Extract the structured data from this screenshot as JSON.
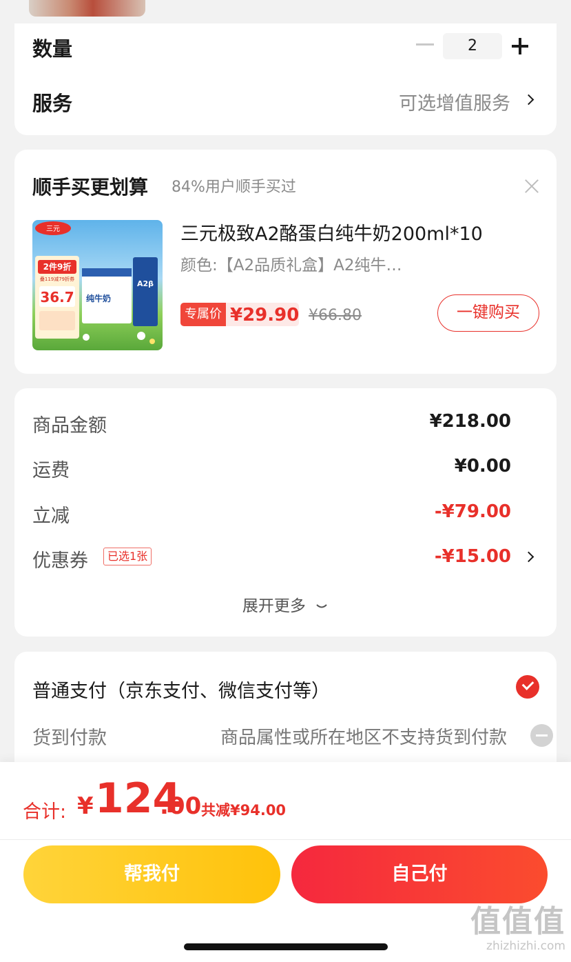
{
  "quantity": {
    "label": "数量",
    "value": "2"
  },
  "service": {
    "label": "服务",
    "value": "可选增值服务"
  },
  "upsell": {
    "title": "顺手买更划算",
    "subtitle": "84%用户顺手买过",
    "product": {
      "title": "三元极致A2酪蛋白纯牛奶200ml*10",
      "variant": "颜色:【A2品质礼盒】A2纯牛…",
      "price_label": "专属价",
      "price": "¥29.90",
      "original_price": "¥66.80",
      "buy_button": "一键购买",
      "image_texts": {
        "brand": "三元",
        "promo": "2件9折",
        "promo_sub": "叠119减79折券",
        "price": "36.7",
        "pack": "纯牛奶",
        "pack_label": "A2β"
      }
    }
  },
  "summary": {
    "rows": [
      {
        "label": "商品金额",
        "value": "¥218.00"
      },
      {
        "label": "运费",
        "value": "¥0.00"
      },
      {
        "label": "立减",
        "value": "-¥79.00"
      },
      {
        "label": "优惠券",
        "value": "-¥15.00",
        "badge": "已选1张"
      }
    ],
    "expand": "展开更多"
  },
  "payment": {
    "normal": "普通支付（京东支付、微信支付等）",
    "cod_label": "货到付款",
    "cod_note": "商品属性或所在地区不支持货到付款"
  },
  "total": {
    "label": "合计:",
    "currency": "¥",
    "integer": "124",
    "decimal": ".00",
    "saved": "共减¥94.00"
  },
  "actions": {
    "help_pay": "帮我付",
    "self_pay": "自己付"
  },
  "watermark": {
    "logo": "值值值",
    "url": "zhizhizhi.com"
  },
  "colors": {
    "accent": "#e8302a",
    "help_button": "#ffc20a"
  }
}
